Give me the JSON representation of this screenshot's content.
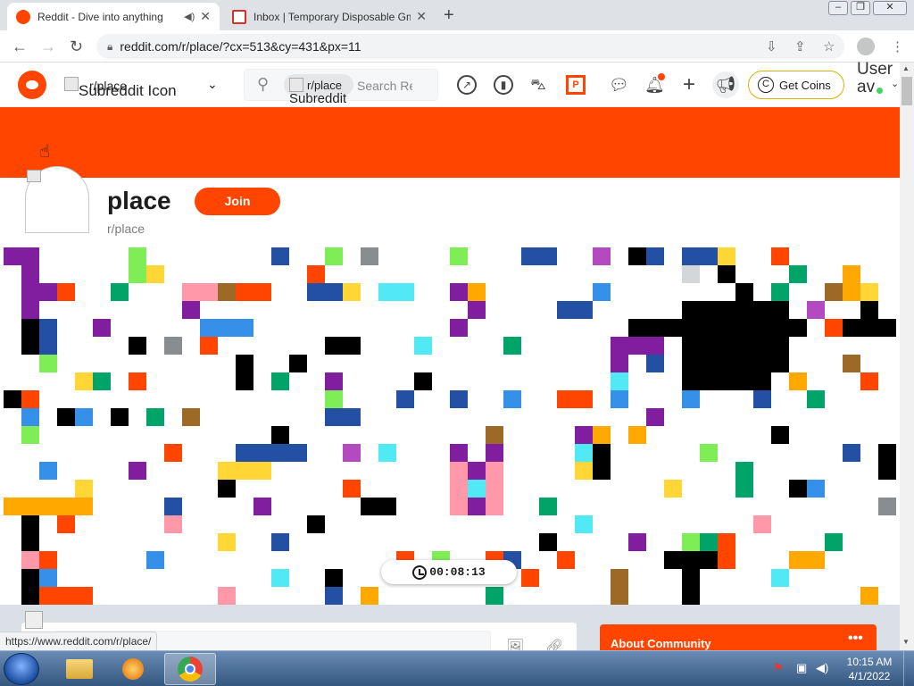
{
  "browser": {
    "tabs": [
      {
        "title": "Reddit - Dive into anything",
        "active": true
      },
      {
        "title": "Inbox | Temporary Disposable Gm",
        "active": false
      }
    ],
    "url": "reddit.com/r/place/?cx=513&cy=431&px=11",
    "status_url": "https://www.reddit.com/r/place/"
  },
  "reddit": {
    "header": {
      "subreddit_icon_alt": "Subreddit Icon",
      "subreddit_name": "r/place",
      "search_chip": "r/place",
      "search_chip_alt": "Subreddit Icon",
      "search_placeholder": "Search Reddit",
      "coins_label": "Get Coins",
      "user_label": "User av"
    },
    "community": {
      "title": "place",
      "join_label": "Join",
      "name": "r/place"
    },
    "timer": "00:08:13",
    "about_title": "About Community",
    "about_more": "•••"
  },
  "taskbar": {
    "time": "10:15 AM",
    "date": "4/1/2022"
  },
  "colors": {
    "reddit_orange": "#ff4500",
    "taskbar": "#34577f"
  },
  "icons": [
    "reddit-logo-icon",
    "search-icon",
    "popular-icon",
    "coins-icon",
    "mod-icon",
    "chat-icon",
    "notification-icon",
    "create-post-icon",
    "advertise-icon",
    "timer-icon"
  ]
}
